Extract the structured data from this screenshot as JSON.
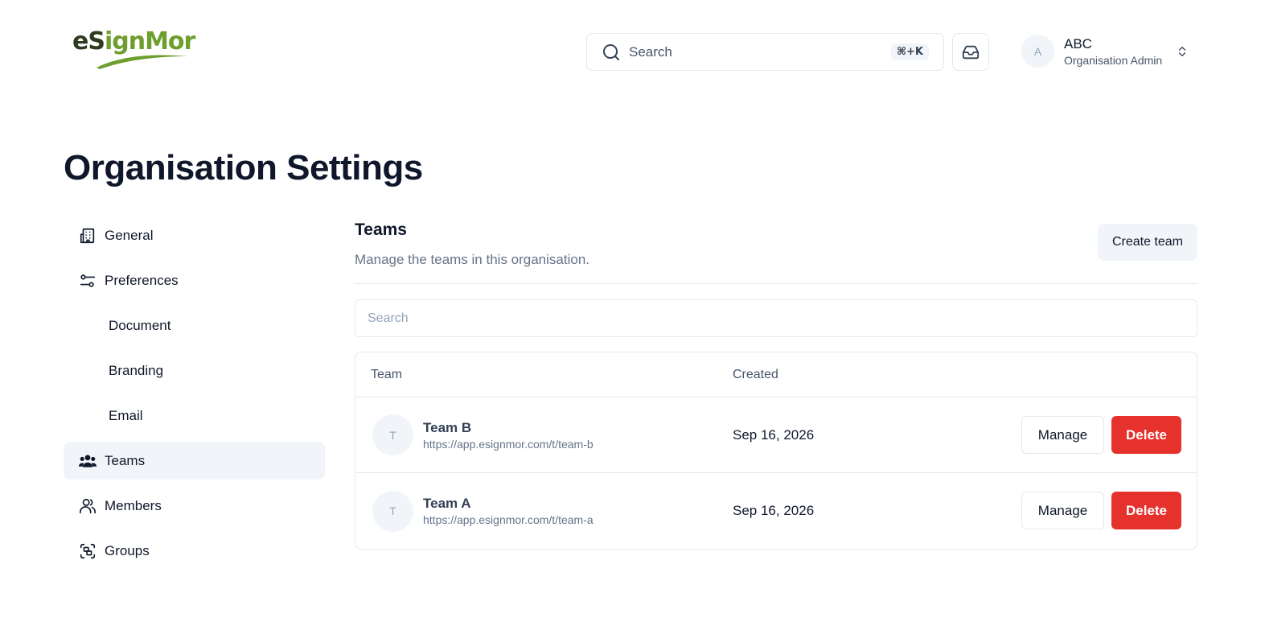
{
  "header": {
    "logo": {
      "part1": "eS",
      "part2": "ign",
      "part3": "Mor"
    },
    "search": {
      "placeholder": "Search",
      "shortcut": "⌘+K"
    },
    "user": {
      "initial": "A",
      "name": "ABC",
      "role": "Organisation Admin"
    }
  },
  "page": {
    "title": "Organisation Settings"
  },
  "sidebar": {
    "items": [
      {
        "label": "General",
        "icon": "building-icon"
      },
      {
        "label": "Preferences",
        "icon": "sliders-icon"
      },
      {
        "label": "Document"
      },
      {
        "label": "Branding"
      },
      {
        "label": "Email"
      },
      {
        "label": "Teams",
        "icon": "users-icon",
        "active": true
      },
      {
        "label": "Members",
        "icon": "user-icon"
      },
      {
        "label": "Groups",
        "icon": "group-scan-icon"
      }
    ]
  },
  "teams": {
    "title": "Teams",
    "description": "Manage the teams in this organisation.",
    "create_label": "Create team",
    "search_placeholder": "Search",
    "columns": {
      "team": "Team",
      "created": "Created"
    },
    "rows": [
      {
        "initial": "T",
        "name": "Team B",
        "url": "https://app.esignmor.com/t/team-b",
        "created": "Sep 16, 2026",
        "manage": "Manage",
        "delete": "Delete"
      },
      {
        "initial": "T",
        "name": "Team A",
        "url": "https://app.esignmor.com/t/team-a",
        "created": "Sep 16, 2026",
        "manage": "Manage",
        "delete": "Delete"
      }
    ]
  },
  "colors": {
    "accent_danger": "#e5322d",
    "muted_bg": "#f1f5f9",
    "border": "#e2e8f0",
    "logo_green": "#6e9e2e"
  }
}
